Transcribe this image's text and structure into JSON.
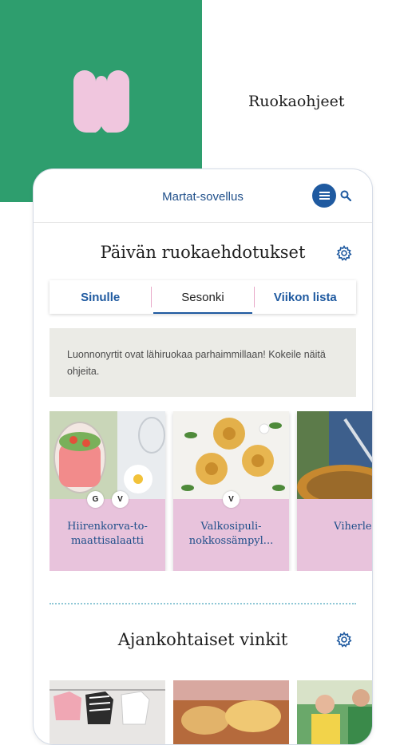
{
  "promo": {
    "title": "Ruokaohjeet"
  },
  "app": {
    "title": "Martat-sovellus",
    "menu_icon": "menu-icon",
    "search_icon": "search-icon"
  },
  "suggestions": {
    "title": "Päivän ruokaehdotukset",
    "settings_icon": "gear-icon",
    "tabs": [
      {
        "label": "Sinulle",
        "active": false
      },
      {
        "label": "Sesonki",
        "active": true
      },
      {
        "label": "Viikon lista",
        "active": false
      }
    ],
    "note": "Luonnonyrtit ovat lähiruokaa parhaimmillaan! Kokeile näitä ohjeita.",
    "cards": [
      {
        "title": "Hiirenkorva-to-maattisalaatti",
        "badges": [
          "G",
          "V"
        ]
      },
      {
        "title": "Valkosipuli-nokkossämpyl...",
        "badges": [
          "V"
        ]
      },
      {
        "title": "Viherlet",
        "badges": []
      }
    ]
  },
  "tips": {
    "title": "Ajankohtaiset vinkit",
    "settings_icon": "gear-icon"
  },
  "colors": {
    "brand_green": "#2e9e6e",
    "brand_blue": "#1f5aa0",
    "card_pink": "#e8c3dc",
    "logo_pink": "#f0c6de"
  }
}
